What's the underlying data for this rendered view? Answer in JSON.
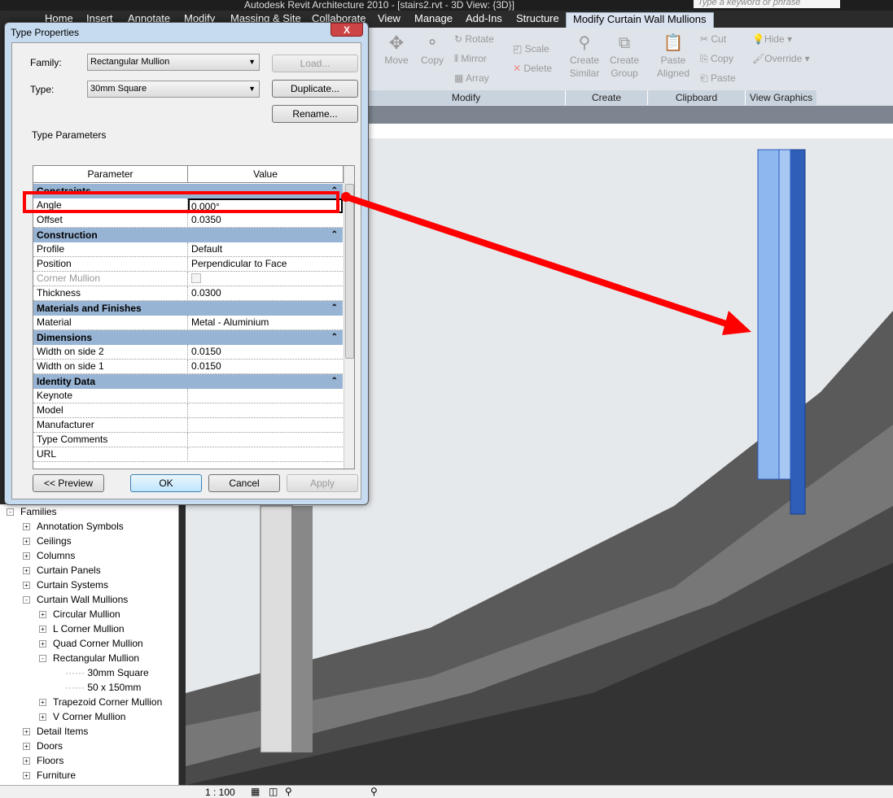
{
  "app": {
    "title": "Autodesk Revit Architecture 2010 - [stairs2.rvt - 3D View: {3D}]",
    "search_placeholder": "Type a keyword or phrase"
  },
  "tabs": [
    "Home",
    "Insert",
    "Annotate",
    "Modify",
    "Massing & Site",
    "Collaborate",
    "View",
    "Manage",
    "Add-Ins",
    "Structure",
    "Modify Curtain Wall Mullions"
  ],
  "ribbon": {
    "move": "Move",
    "copy": "Copy",
    "rotate": "Rotate",
    "mirror": "Mirror",
    "array": "Array",
    "scale": "Scale",
    "delete": "Delete",
    "create_similar": "Create Similar",
    "create_group": "Create Group",
    "paste_aligned": "Paste Aligned",
    "cut": "Cut",
    "copy2": "Copy",
    "paste": "Paste",
    "hide": "Hide",
    "override": "Override",
    "panels": [
      "Modify",
      "Create",
      "Clipboard",
      "View Graphics"
    ]
  },
  "dialog": {
    "title": "Type Properties",
    "close": "X",
    "family_label": "Family:",
    "family_value": "Rectangular Mullion",
    "type_label": "Type:",
    "type_value": "30mm Square",
    "load": "Load...",
    "duplicate": "Duplicate...",
    "rename": "Rename...",
    "type_parameters": "Type Parameters",
    "col_parameter": "Parameter",
    "col_value": "Value",
    "preview": "<< Preview",
    "ok": "OK",
    "cancel": "Cancel",
    "apply": "Apply",
    "sections": [
      {
        "name": "Constraints",
        "rows": [
          {
            "p": "Angle",
            "v": "0.000°"
          },
          {
            "p": "Offset",
            "v": "0.0350"
          }
        ]
      },
      {
        "name": "Construction",
        "rows": [
          {
            "p": "Profile",
            "v": "Default"
          },
          {
            "p": "Position",
            "v": "Perpendicular to Face"
          },
          {
            "p": "Corner Mullion",
            "v": ""
          },
          {
            "p": "Thickness",
            "v": "0.0300"
          }
        ]
      },
      {
        "name": "Materials and Finishes",
        "rows": [
          {
            "p": "Material",
            "v": "Metal - Aluminium"
          }
        ]
      },
      {
        "name": "Dimensions",
        "rows": [
          {
            "p": "Width on side 2",
            "v": "0.0150"
          },
          {
            "p": "Width on side 1",
            "v": "0.0150"
          }
        ]
      },
      {
        "name": "Identity Data",
        "rows": [
          {
            "p": "Keynote",
            "v": ""
          },
          {
            "p": "Model",
            "v": ""
          },
          {
            "p": "Manufacturer",
            "v": ""
          },
          {
            "p": "Type Comments",
            "v": ""
          },
          {
            "p": "URL",
            "v": ""
          }
        ]
      }
    ]
  },
  "browser": {
    "items": [
      {
        "label": "Families",
        "level": 0,
        "state": "-"
      },
      {
        "label": "Annotation Symbols",
        "level": 1,
        "state": "+"
      },
      {
        "label": "Ceilings",
        "level": 1,
        "state": "+"
      },
      {
        "label": "Columns",
        "level": 1,
        "state": "+"
      },
      {
        "label": "Curtain Panels",
        "level": 1,
        "state": "+"
      },
      {
        "label": "Curtain Systems",
        "level": 1,
        "state": "+"
      },
      {
        "label": "Curtain Wall Mullions",
        "level": 1,
        "state": "-"
      },
      {
        "label": "Circular Mullion",
        "level": 2,
        "state": "+"
      },
      {
        "label": "L Corner Mullion",
        "level": 2,
        "state": "+"
      },
      {
        "label": "Quad Corner Mullion",
        "level": 2,
        "state": "+"
      },
      {
        "label": "Rectangular Mullion",
        "level": 2,
        "state": "-"
      },
      {
        "label": "30mm Square",
        "level": 3,
        "state": ""
      },
      {
        "label": "50 x 150mm",
        "level": 3,
        "state": ""
      },
      {
        "label": "Trapezoid Corner Mullion",
        "level": 2,
        "state": "+"
      },
      {
        "label": "V Corner Mullion",
        "level": 2,
        "state": "+"
      },
      {
        "label": "Detail Items",
        "level": 1,
        "state": "+"
      },
      {
        "label": "Doors",
        "level": 1,
        "state": "+"
      },
      {
        "label": "Floors",
        "level": 1,
        "state": "+"
      },
      {
        "label": "Furniture",
        "level": 1,
        "state": "+"
      }
    ]
  },
  "status": {
    "scale": "1 : 100"
  }
}
